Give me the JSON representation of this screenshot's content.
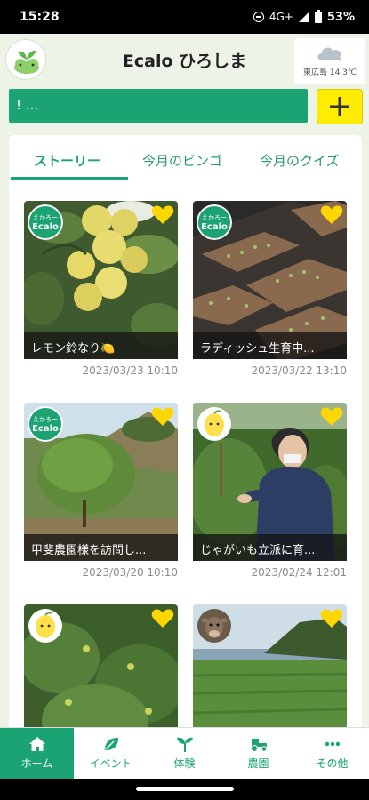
{
  "status_bar": {
    "time": "15:28",
    "network": "4G+",
    "battery": "53%"
  },
  "header": {
    "title": "Ecalo ひろしま",
    "weather": {
      "location": "東広島",
      "temp": "14.3℃",
      "icon": "cloud-icon"
    }
  },
  "search": {
    "value": "! ..."
  },
  "add_button": {
    "icon": "plus-icon"
  },
  "tabs": [
    {
      "label": "ストーリー",
      "active": true
    },
    {
      "label": "今月のビンゴ",
      "active": false
    },
    {
      "label": "今月のクイズ",
      "active": false
    }
  ],
  "cards": [
    {
      "caption": "レモン鈴なり🍋",
      "date": "2023/03/23 10:10",
      "badge": "ecalo-badge"
    },
    {
      "caption": "ラディッシュ生育中...",
      "date": "2023/03/22 13:10",
      "badge": "ecalo-badge"
    },
    {
      "caption": "甲斐農園様を訪問し...",
      "date": "2023/03/20 10:10",
      "badge": "ecalo-badge"
    },
    {
      "caption": "じゃがいも立派に育...",
      "date": "2023/02/24 12:01",
      "badge": "lemon-avatar"
    },
    {
      "caption": "",
      "date": "",
      "badge": "lemon-avatar"
    },
    {
      "caption": "",
      "date": "",
      "badge": "cow-avatar"
    }
  ],
  "badge_text": {
    "top": "えかろー",
    "bottom": "Ecalo"
  },
  "bottom_nav": [
    {
      "label": "ホーム",
      "icon": "home-icon",
      "active": true
    },
    {
      "label": "イベント",
      "icon": "leaf-icon",
      "active": false
    },
    {
      "label": "体験",
      "icon": "sprout-icon",
      "active": false
    },
    {
      "label": "農園",
      "icon": "tractor-icon",
      "active": false
    },
    {
      "label": "その他",
      "icon": "more-icon",
      "active": false
    }
  ],
  "colors": {
    "primary": "#1ba373",
    "accent": "#ffec00",
    "background": "#eef3e8"
  }
}
